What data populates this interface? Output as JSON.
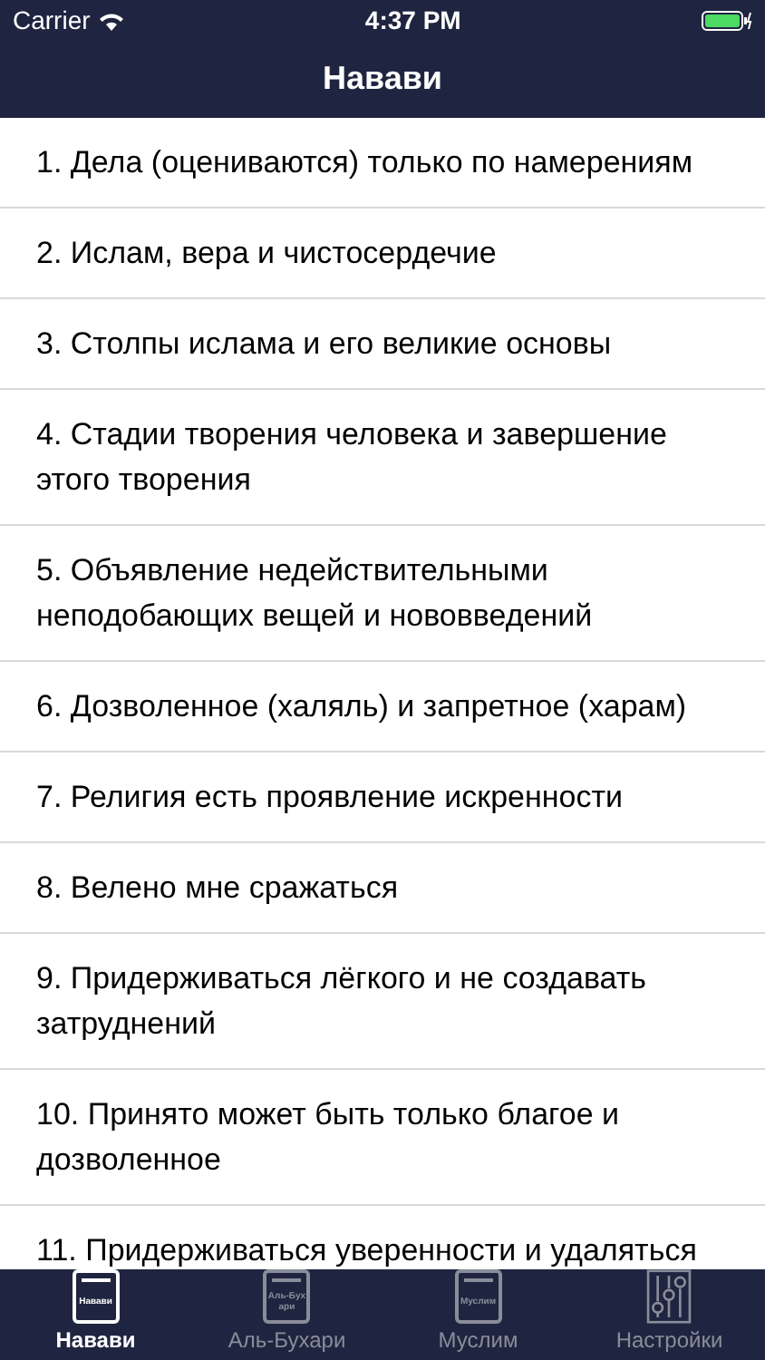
{
  "status_bar": {
    "carrier": "Carrier",
    "time": "4:37 PM"
  },
  "nav_bar": {
    "title": "Навави"
  },
  "items": [
    {
      "text": "1. Дела (оцениваются) только по намерениям"
    },
    {
      "text": "2. Ислам, вера и чистосердечие"
    },
    {
      "text": "3. Столпы ислама и его великие основы"
    },
    {
      "text": "4. Стадии творения человека и завершение этого творения"
    },
    {
      "text": "5. Объявление недействительными неподобающих вещей и нововведений"
    },
    {
      "text": "6. Дозволенное (халяль) и запретное (харам)"
    },
    {
      "text": "7. Религия есть проявление искренности"
    },
    {
      "text": "8. Велено мне сражаться"
    },
    {
      "text": "9. Придерживаться лёгкого и не создавать затруднений"
    },
    {
      "text": "10. Принято может быть только благое и дозволенное"
    },
    {
      "text": "11. Придерживаться уверенности и удаляться"
    }
  ],
  "tab_bar": [
    {
      "kind": "book",
      "book_label": "Навави",
      "label": "Навави",
      "selected": true
    },
    {
      "kind": "book",
      "book_label": "Аль-Бухари",
      "label": "Аль-Бухари",
      "selected": false
    },
    {
      "kind": "book",
      "book_label": "Муслим",
      "label": "Муслим",
      "selected": false
    },
    {
      "kind": "settings",
      "label": "Настройки",
      "selected": false
    }
  ]
}
